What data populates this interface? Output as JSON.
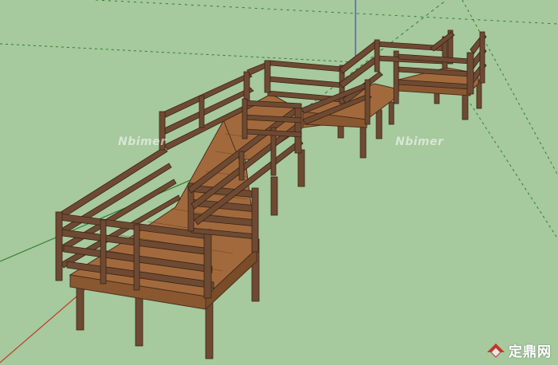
{
  "viewport": {
    "background": "#a6c99e",
    "axis_green": "#3d8f3d",
    "axis_blue": "#3d48d8",
    "axis_red": "#c0392b"
  },
  "model": {
    "rail_color": "#6e4a33",
    "rail_dark": "#4a2f1f",
    "deck_color": "#a26a3c",
    "deck_dark": "#8a5830"
  },
  "watermarks": [
    "Nbimer",
    "Nbimer"
  ],
  "logo": {
    "text": "定鼎网",
    "icon": "dingding-logo-icon",
    "color": "#c0392b"
  }
}
